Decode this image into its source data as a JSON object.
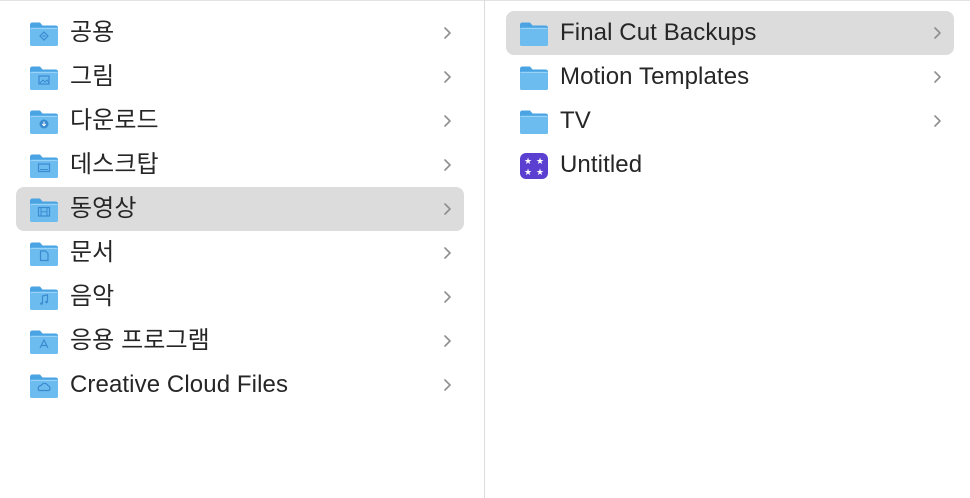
{
  "left_column": {
    "selected_index": 4,
    "items": [
      {
        "label": "공용",
        "icon": "public-folder-icon"
      },
      {
        "label": "그림",
        "icon": "pictures-folder-icon"
      },
      {
        "label": "다운로드",
        "icon": "downloads-folder-icon"
      },
      {
        "label": "데스크탑",
        "icon": "desktop-folder-icon"
      },
      {
        "label": "동영상",
        "icon": "movies-folder-icon"
      },
      {
        "label": "문서",
        "icon": "documents-folder-icon"
      },
      {
        "label": "음악",
        "icon": "music-folder-icon"
      },
      {
        "label": "응용 프로그램",
        "icon": "applications-folder-icon"
      },
      {
        "label": "Creative Cloud Files",
        "icon": "creative-cloud-folder-icon"
      }
    ]
  },
  "right_column": {
    "selected_index": 0,
    "items": [
      {
        "label": "Final Cut Backups",
        "icon": "folder-icon",
        "has_children": true
      },
      {
        "label": "Motion Templates",
        "icon": "folder-icon",
        "has_children": true
      },
      {
        "label": "TV",
        "icon": "folder-icon",
        "has_children": true
      },
      {
        "label": "Untitled",
        "icon": "imovie-library-icon",
        "has_children": false
      }
    ]
  },
  "colors": {
    "folder_body": "#6cbcf0",
    "folder_tab": "#4aa3e2",
    "selection": "#dcdcdc",
    "chevron": "#8e8e8e",
    "library_purple": "#5b3fd0"
  }
}
